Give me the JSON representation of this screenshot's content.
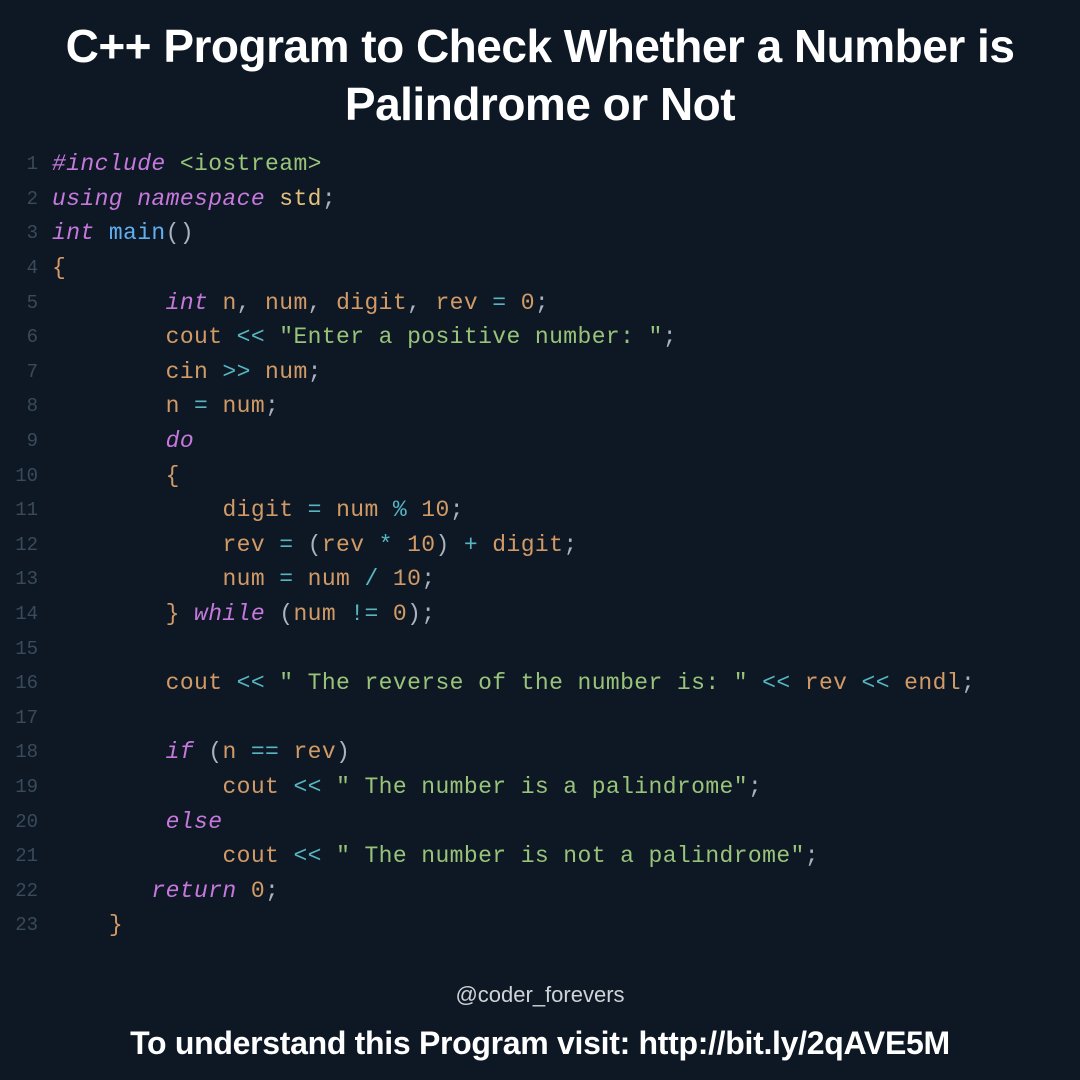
{
  "title": "C++ Program to Check Whether a Number is Palindrome or Not",
  "watermark": "@coder_forevers",
  "footer": "To understand this Program visit: http://bit.ly/2qAVE5M",
  "lines": {
    "l1": {
      "n": "1"
    },
    "l2": {
      "n": "2"
    },
    "l3": {
      "n": "3"
    },
    "l4": {
      "n": "4"
    },
    "l5": {
      "n": "5"
    },
    "l6": {
      "n": "6"
    },
    "l7": {
      "n": "7"
    },
    "l8": {
      "n": "8"
    },
    "l9": {
      "n": "9"
    },
    "l10": {
      "n": "10"
    },
    "l11": {
      "n": "11"
    },
    "l12": {
      "n": "12"
    },
    "l13": {
      "n": "13"
    },
    "l14": {
      "n": "14"
    },
    "l15": {
      "n": "15"
    },
    "l16": {
      "n": "16"
    },
    "l17": {
      "n": "17"
    },
    "l18": {
      "n": "18"
    },
    "l19": {
      "n": "19"
    },
    "l20": {
      "n": "20"
    },
    "l21": {
      "n": "21"
    },
    "l22": {
      "n": "22"
    },
    "l23": {
      "n": "23"
    }
  },
  "tok": {
    "include": "#include ",
    "iostream": "<iostream>",
    "using": "using ",
    "namespace": "namespace ",
    "std": "std",
    "semi": ";",
    "int_": "int ",
    "main": "main",
    "lpar": "(",
    "rpar": ")",
    "lbrace": "{",
    "rbrace": "}",
    "n": "n",
    "comma": ", ",
    "num": "num",
    "digit": "digit",
    "rev": "rev",
    "eq": " = ",
    "zero": "0",
    "cout": "cout",
    "ltlt": " << ",
    "str_enter": "\"Enter a positive number: \"",
    "cin": "cin",
    "gtgt": " >> ",
    "do": "do",
    "mod": " % ",
    "ten": "10",
    "star": " * ",
    "plus": " + ",
    "div": " / ",
    "while": " while ",
    "neq": " != ",
    "str_reverse": "\" The reverse of the number is: \"",
    "endl": "endl",
    "if": "if ",
    "eqeq": " == ",
    "str_yes": "\" The number is a palindrome\"",
    "else": "else",
    "str_no": "\" The number is not a palindrome\"",
    "return": "return "
  }
}
